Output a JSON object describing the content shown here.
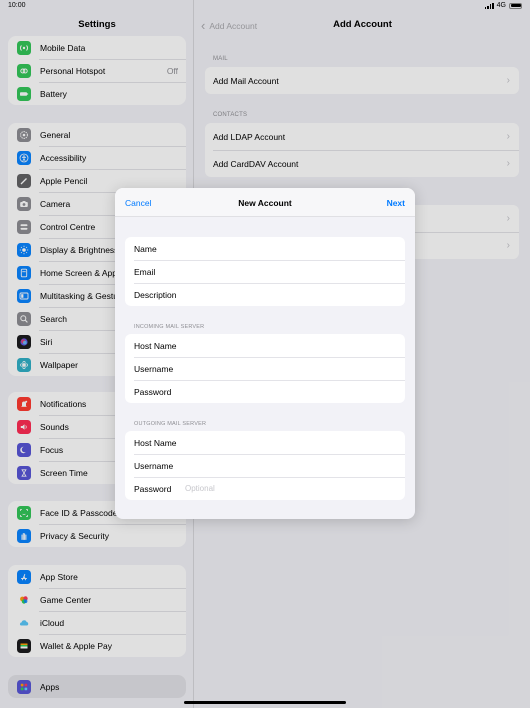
{
  "status_bar": {
    "time": "10:00",
    "network": "4G"
  },
  "sidebar": {
    "title": "Settings",
    "groups": [
      [
        {
          "label": "Mobile Data",
          "icon": "antenna-icon",
          "color": "#34c759"
        },
        {
          "label": "Personal Hotspot",
          "value": "Off",
          "icon": "hotspot-icon",
          "color": "#34c759"
        },
        {
          "label": "Battery",
          "icon": "battery-icon",
          "color": "#34c759"
        }
      ],
      [
        {
          "label": "General",
          "icon": "gear-icon",
          "color": "#8e8e93"
        },
        {
          "label": "Accessibility",
          "icon": "accessibility-icon",
          "color": "#0a84ff"
        },
        {
          "label": "Apple Pencil",
          "icon": "pencil-icon",
          "color": "#636366"
        },
        {
          "label": "Camera",
          "icon": "camera-icon",
          "color": "#8e8e93"
        },
        {
          "label": "Control Centre",
          "icon": "control-centre-icon",
          "color": "#8e8e93"
        },
        {
          "label": "Display & Brightness",
          "icon": "brightness-icon",
          "color": "#0a84ff"
        },
        {
          "label": "Home Screen & App Library",
          "icon": "home-screen-icon",
          "color": "#0a84ff"
        },
        {
          "label": "Multitasking & Gestures",
          "icon": "multitasking-icon",
          "color": "#0a84ff"
        },
        {
          "label": "Search",
          "icon": "search-icon",
          "color": "#8e8e93"
        },
        {
          "label": "Siri",
          "icon": "siri-icon",
          "color": "#3a3a3c"
        },
        {
          "label": "Wallpaper",
          "icon": "wallpaper-icon",
          "color": "#30b0c7"
        }
      ],
      [
        {
          "label": "Notifications",
          "icon": "notifications-icon",
          "color": "#ff3b30"
        },
        {
          "label": "Sounds",
          "icon": "sounds-icon",
          "color": "#ff2d55"
        },
        {
          "label": "Focus",
          "icon": "moon-icon",
          "color": "#5856d6"
        },
        {
          "label": "Screen Time",
          "icon": "hourglass-icon",
          "color": "#5856d6"
        }
      ],
      [
        {
          "label": "Face ID & Passcode",
          "icon": "face-id-icon",
          "color": "#34c759"
        },
        {
          "label": "Privacy & Security",
          "icon": "hand-icon",
          "color": "#0a84ff"
        }
      ],
      [
        {
          "label": "App Store",
          "icon": "app-store-icon",
          "color": "#0a84ff"
        },
        {
          "label": "Game Center",
          "icon": "game-center-icon",
          "color": "#ff9500"
        },
        {
          "label": "iCloud",
          "icon": "cloud-icon",
          "color": "#5ac8fa"
        },
        {
          "label": "Wallet & Apple Pay",
          "icon": "wallet-icon",
          "color": "#1c1c1e"
        }
      ],
      [
        {
          "label": "Apps",
          "icon": "apps-icon",
          "color": "#5856d6"
        }
      ]
    ]
  },
  "detail": {
    "back_label": "Add Account",
    "title": "Add Account",
    "mail_section": "MAIL",
    "add_mail_account": "Add Mail Account",
    "contacts_section": "CONTACTS",
    "add_ldap_account": "Add LDAP Account",
    "add_carddav_account": "Add CardDAV Account"
  },
  "modal": {
    "cancel": "Cancel",
    "title": "New Account",
    "next": "Next",
    "name_label": "Name",
    "email_label": "Email",
    "description_label": "Description",
    "incoming_section": "INCOMING MAIL SERVER",
    "incoming": {
      "host_label": "Host Name",
      "username_label": "Username",
      "password_label": "Password"
    },
    "outgoing_section": "OUTGOING MAIL SERVER",
    "outgoing": {
      "host_label": "Host Name",
      "username_label": "Username",
      "password_label": "Password",
      "password_placeholder": "Optional"
    }
  }
}
